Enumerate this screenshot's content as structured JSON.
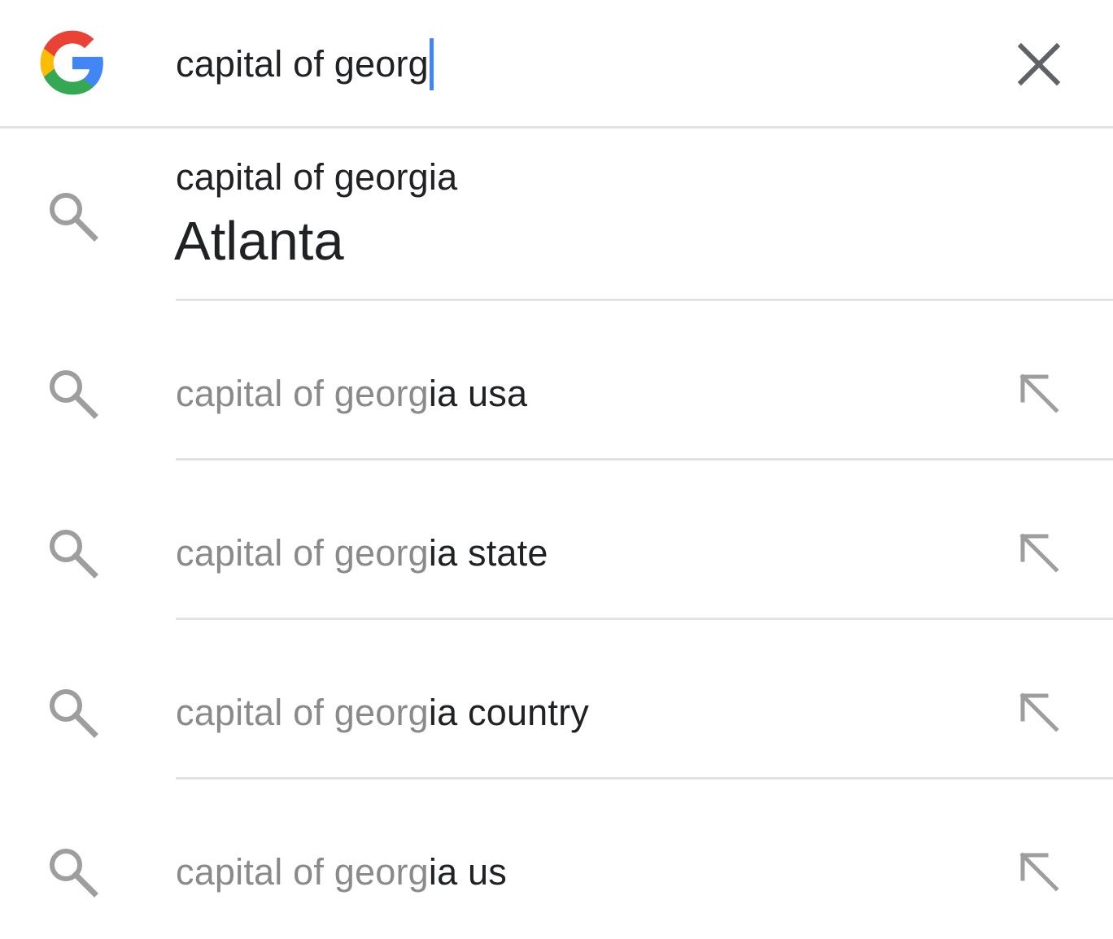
{
  "search": {
    "query": "capital of georg",
    "logo_icon": "google-g-icon",
    "clear_icon": "close-icon",
    "caret_color": "#4285f4"
  },
  "answer": {
    "query": "capital of georgia",
    "value": "Atlanta",
    "icon": "search-icon"
  },
  "suggestions": [
    {
      "typed": "capital of georg",
      "completion": "ia usa",
      "icon": "search-icon",
      "action_icon": "arrow-up-left-icon"
    },
    {
      "typed": "capital of georg",
      "completion": "ia state",
      "icon": "search-icon",
      "action_icon": "arrow-up-left-icon"
    },
    {
      "typed": "capital of georg",
      "completion": "ia country",
      "icon": "search-icon",
      "action_icon": "arrow-up-left-icon"
    },
    {
      "typed": "capital of georg",
      "completion": "ia us",
      "icon": "search-icon",
      "action_icon": "arrow-up-left-icon"
    }
  ],
  "colors": {
    "typed_text": "#8a8a8a",
    "completion_text": "#202124",
    "divider": "#e3e3e3",
    "icon_gray": "#9e9e9e",
    "google_blue": "#4285f4",
    "google_red": "#ea4335",
    "google_yellow": "#fbbc05",
    "google_green": "#34a853"
  }
}
